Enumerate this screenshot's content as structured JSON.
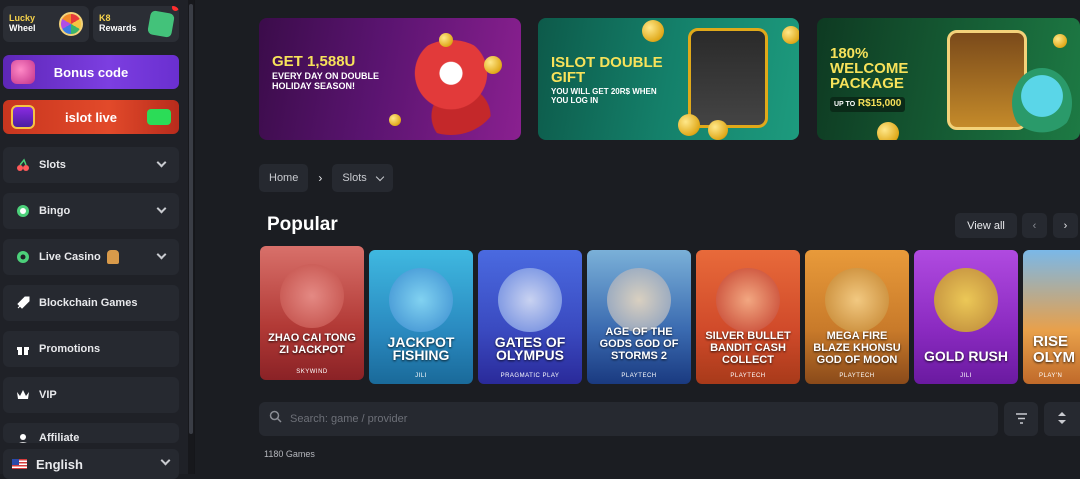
{
  "sidebar": {
    "tiles": [
      {
        "line1": "Lucky",
        "line2": "Wheel",
        "icon": "wheel-icon"
      },
      {
        "line1": "K8",
        "line2": "Rewards",
        "icon": "gift-icon"
      }
    ],
    "bonus_label": "Bonus code",
    "live_label": "islot live",
    "nav": [
      {
        "label": "Slots",
        "icon": "cherry-icon",
        "has_chevron": true
      },
      {
        "label": "Bingo",
        "icon": "bingo-ball-icon",
        "has_chevron": true
      },
      {
        "label": "Live Casino",
        "icon": "roulette-icon",
        "has_chevron": true
      },
      {
        "label": "Blockchain Games",
        "icon": "rocket-icon",
        "has_chevron": false
      },
      {
        "label": "Promotions",
        "icon": "gift-icon",
        "has_chevron": false
      },
      {
        "label": "VIP",
        "icon": "crown-icon",
        "has_chevron": false
      },
      {
        "label": "Affiliate",
        "icon": "users-icon",
        "has_chevron": false
      }
    ],
    "language": "English"
  },
  "banners": [
    {
      "title": "GET 1,588U",
      "subtitle": "EVERY DAY ON DOUBLE HOLIDAY SEASON!"
    },
    {
      "title": "ISLOT DOUBLE GIFT",
      "subtitle": "YOU WILL GET 20R$ WHEN YOU LOG IN"
    },
    {
      "title": "180% WELCOME PACKAGE",
      "subtitle_prefix": "UP TO",
      "subtitle": "R$15,000"
    }
  ],
  "breadcrumb": {
    "home": "Home",
    "current": "Slots"
  },
  "section": {
    "title": "Popular",
    "view_all": "View all"
  },
  "games": [
    {
      "title": "ZHAO CAI TONG ZI JACKPOT",
      "provider": "SKYWIND"
    },
    {
      "title": "JACKPOT FISHING",
      "provider": "JILI"
    },
    {
      "title": "GATES OF OLYMPUS",
      "provider": "PRAGMATIC PLAY"
    },
    {
      "title": "AGE OF THE GODS GOD OF STORMS 2",
      "provider": "PLAYTECH"
    },
    {
      "title": "SILVER BULLET BANDIT CASH COLLECT",
      "provider": "PLAYTECH"
    },
    {
      "title": "MEGA FIRE BLAZE KHONSU GOD OF MOON",
      "provider": "PLAYTECH"
    },
    {
      "title": "GOLD RUSH",
      "provider": "JILI"
    },
    {
      "title": "RISE OLYM",
      "provider": "PLAY'N"
    }
  ],
  "search": {
    "placeholder": "Search: game / provider"
  },
  "games_count": "1180 Games",
  "colors": {
    "background": "#1b1d22",
    "panel": "#262930",
    "bonus": "#6a2fd0",
    "live": "#d8401f",
    "accent_yellow": "#f7e25a"
  }
}
